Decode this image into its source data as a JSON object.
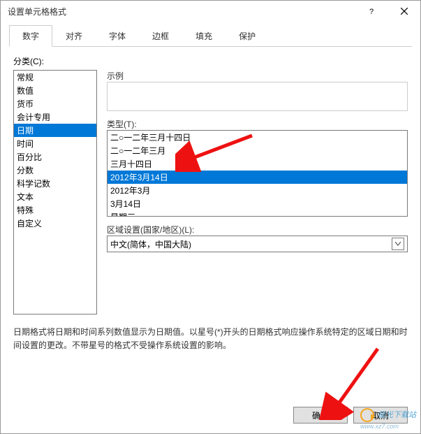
{
  "window": {
    "title": "设置单元格格式"
  },
  "tabs": {
    "items": [
      {
        "label": "数字"
      },
      {
        "label": "对齐"
      },
      {
        "label": "字体"
      },
      {
        "label": "边框"
      },
      {
        "label": "填充"
      },
      {
        "label": "保护"
      }
    ],
    "active_index": 0
  },
  "category": {
    "label": "分类(C):",
    "items": [
      "常规",
      "数值",
      "货币",
      "会计专用",
      "日期",
      "时间",
      "百分比",
      "分数",
      "科学记数",
      "文本",
      "特殊",
      "自定义"
    ],
    "selected_index": 4
  },
  "sample": {
    "label": "示例"
  },
  "type": {
    "label": "类型(T):",
    "items": [
      "二○一二年三月十四日",
      "二○一二年三月",
      "三月十四日",
      "2012年3月14日",
      "2012年3月",
      "3月14日",
      "星期三"
    ],
    "selected_index": 3
  },
  "locale": {
    "label": "区域设置(国家/地区)(L):",
    "value": "中文(简体，中国大陆)"
  },
  "description": "日期格式将日期和时间系列数值显示为日期值。以星号(*)开头的日期格式响应操作系统特定的区域日期和时间设置的更改。不带星号的格式不受操作系统设置的影响。",
  "footer": {
    "ok": "确定",
    "cancel": "取消"
  },
  "watermark": {
    "text": "极光下载站",
    "url": "www.xz7.com"
  }
}
